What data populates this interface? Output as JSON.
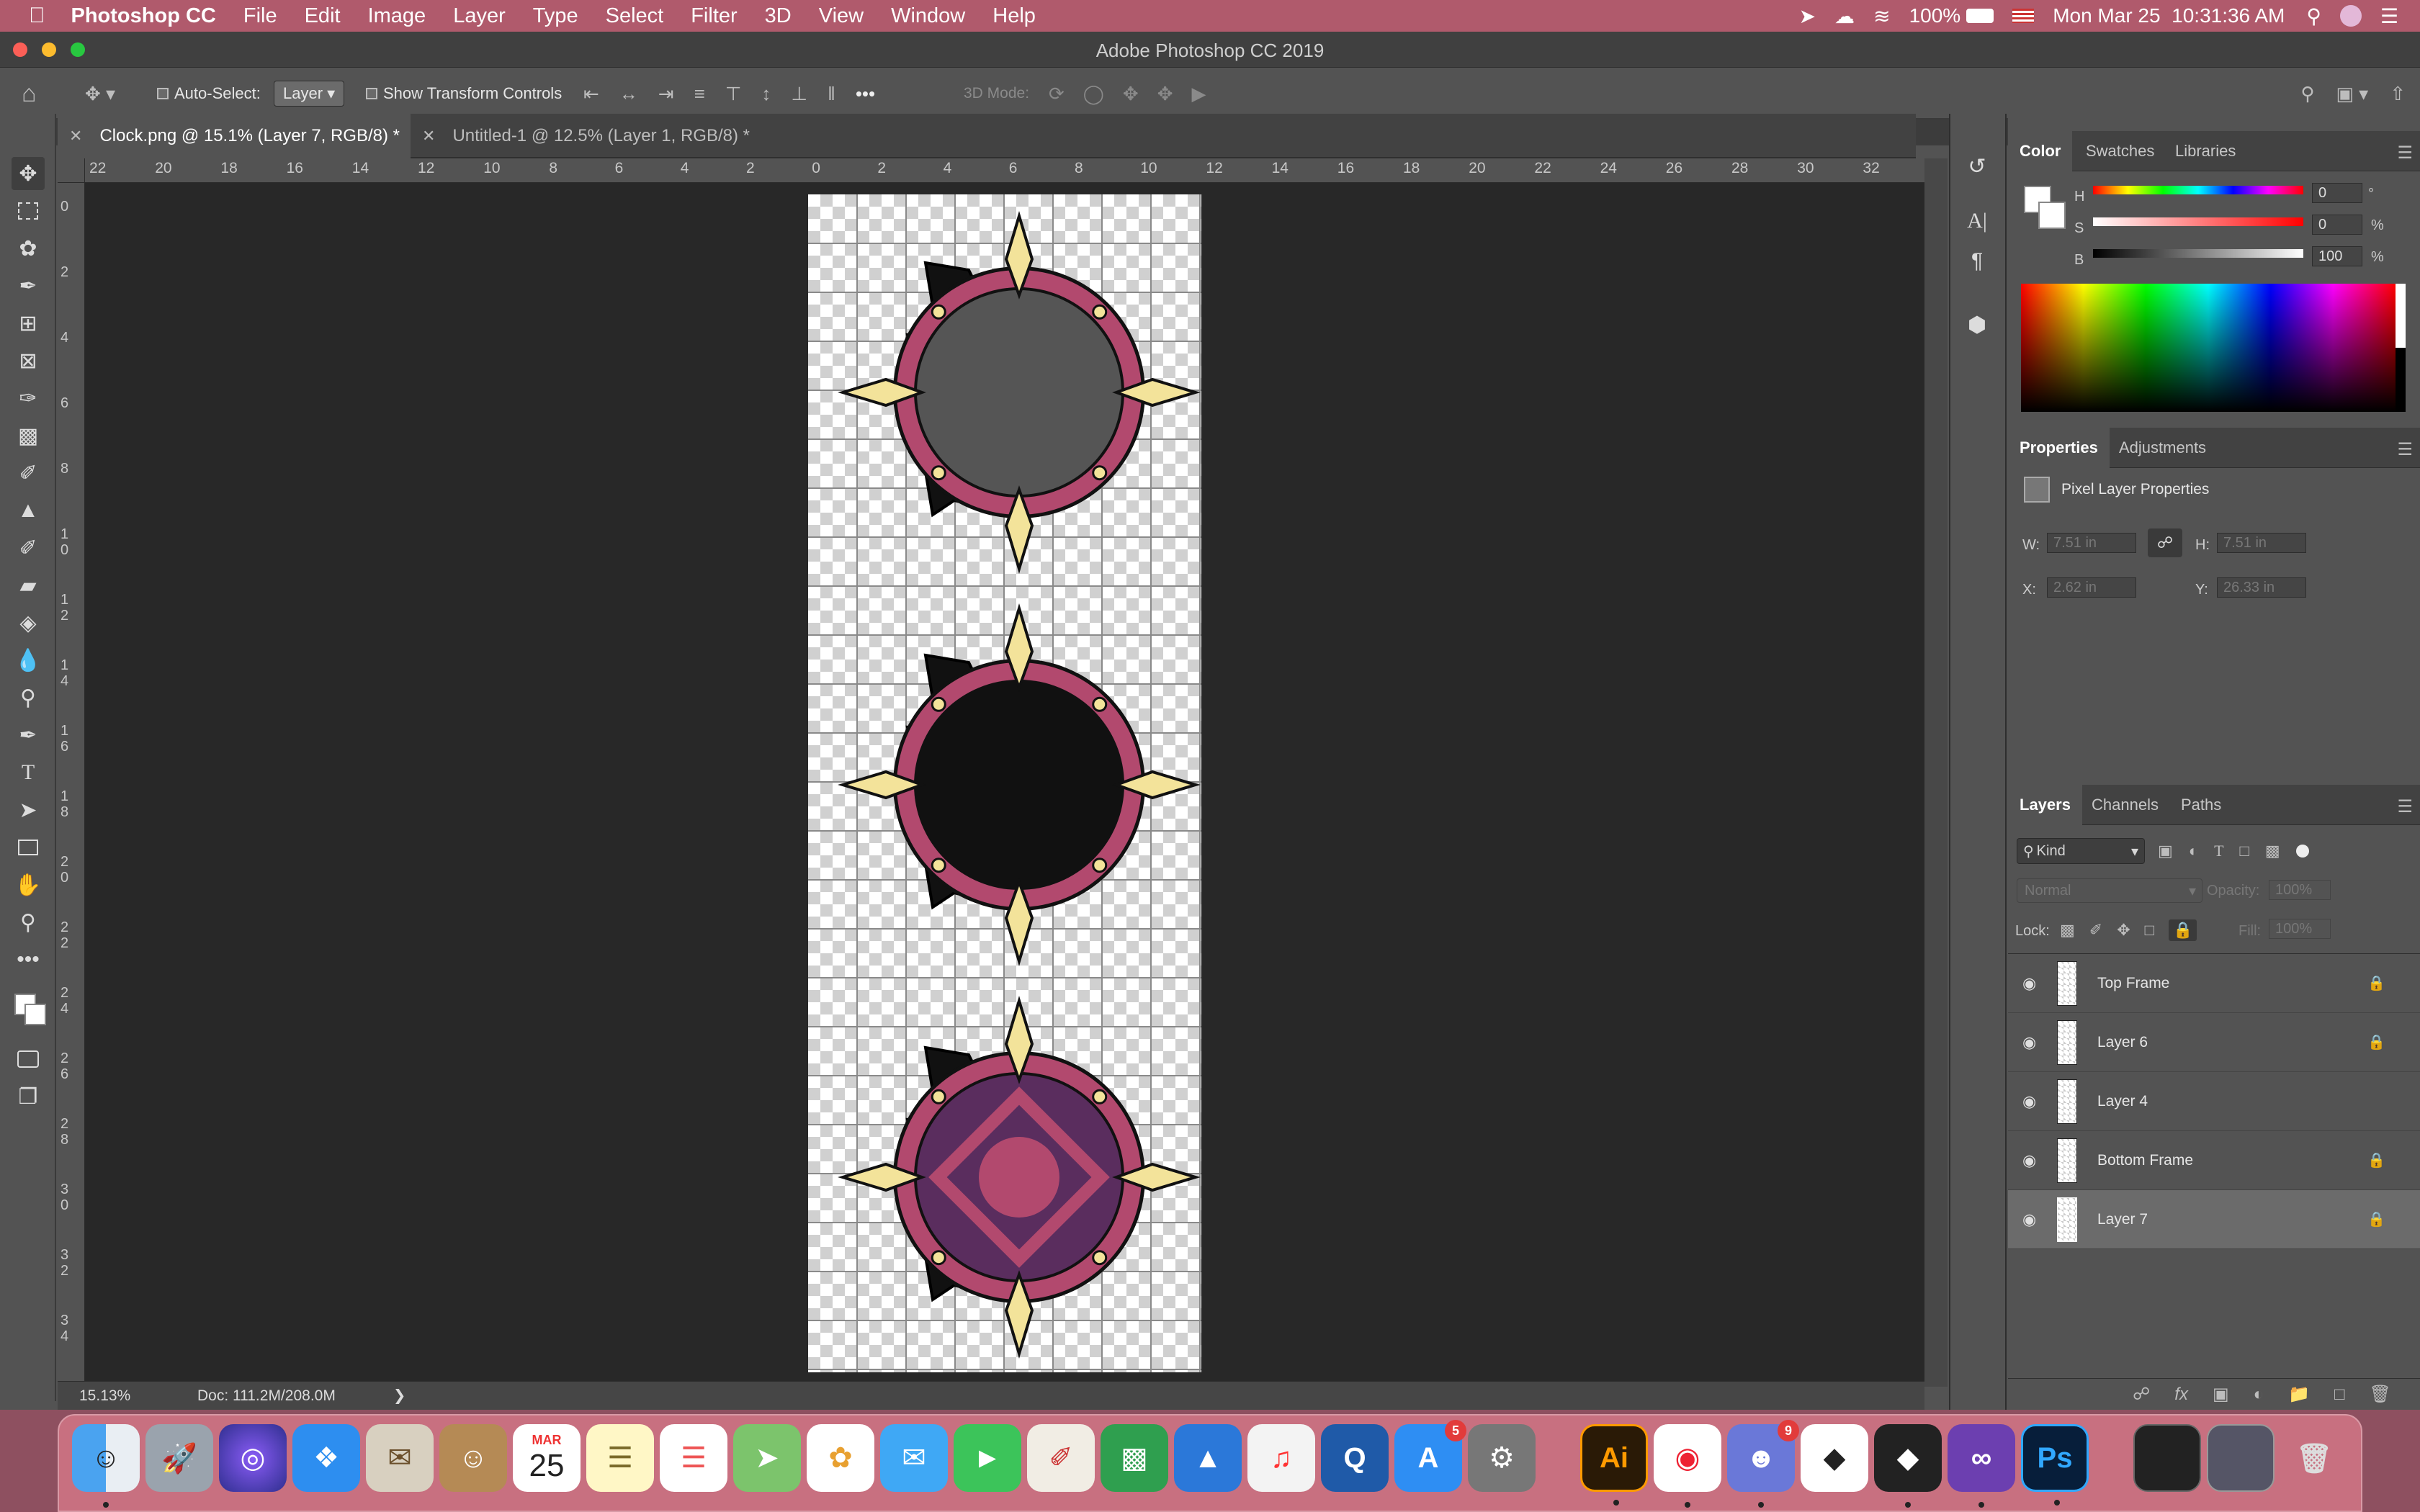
{
  "menubar": {
    "app": "Photoshop CC",
    "items": [
      "File",
      "Edit",
      "Image",
      "Layer",
      "Type",
      "Select",
      "Filter",
      "3D",
      "View",
      "Window",
      "Help"
    ],
    "battery": "100%",
    "datetime": "Mon Mar 25  10:31:36 AM"
  },
  "window": {
    "title": "Adobe Photoshop CC 2019"
  },
  "options": {
    "auto_select": "Auto-Select:",
    "layer_mode": "Layer",
    "show_transform": "Show Transform Controls",
    "mode_3d": "3D Mode:"
  },
  "tabs": [
    {
      "label": "Clock.png @ 15.1% (Layer 7, RGB/8) *"
    },
    {
      "label": "Untitled-1 @ 12.5% (Layer 1, RGB/8) *"
    }
  ],
  "ruler": {
    "h_labels": [
      "22",
      "20",
      "18",
      "16",
      "14",
      "12",
      "10",
      "8",
      "6",
      "4",
      "2",
      "0",
      "2",
      "4",
      "6",
      "8",
      "10",
      "12",
      "14",
      "16",
      "18",
      "20",
      "22",
      "24",
      "26",
      "28",
      "30",
      "32"
    ],
    "v_labels": [
      "0",
      "2",
      "4",
      "6",
      "8",
      "1\n0",
      "1\n2",
      "1\n4",
      "1\n6",
      "1\n8",
      "2\n0",
      "2\n2",
      "2\n4",
      "2\n6",
      "2\n8",
      "3\n0",
      "3\n2",
      "3\n4"
    ]
  },
  "status": {
    "zoom": "15.13%",
    "doc": "Doc: 111.2M/208.0M"
  },
  "color_panel": {
    "tabs": [
      "Color",
      "Swatches",
      "Libraries"
    ],
    "h_label": "H",
    "h_value": "0",
    "h_unit": "°",
    "s_label": "S",
    "s_value": "0",
    "s_unit": "%",
    "b_label": "B",
    "b_value": "100",
    "b_unit": "%"
  },
  "properties": {
    "tabs": [
      "Properties",
      "Adjustments"
    ],
    "heading": "Pixel Layer Properties",
    "w_label": "W:",
    "w_value": "7.51 in",
    "h_label": "H:",
    "h_value": "7.51 in",
    "x_label": "X:",
    "x_value": "2.62 in",
    "y_label": "Y:",
    "y_value": "26.33 in"
  },
  "layers_panel": {
    "tabs": [
      "Layers",
      "Channels",
      "Paths"
    ],
    "kind": "Kind",
    "blend": "Normal",
    "opacity_label": "Opacity:",
    "opacity": "100%",
    "lock_label": "Lock:",
    "fill_label": "Fill:",
    "fill": "100%",
    "layers": [
      {
        "name": "Top Frame",
        "locked": true
      },
      {
        "name": "Layer 6",
        "locked": true
      },
      {
        "name": "Layer 4",
        "locked": false
      },
      {
        "name": "Bottom Frame",
        "locked": true
      },
      {
        "name": "Layer 7",
        "locked": true,
        "selected": true
      }
    ]
  },
  "dock": {
    "calendar_month": "MAR",
    "calendar_day": "25",
    "appstore_badge": "5",
    "discord_badge": "9",
    "illustrator": "Ai",
    "photoshop": "Ps"
  },
  "colors": {
    "menubar": "#b05a6c",
    "ring": "#b2496e",
    "spike": "#f3e39a",
    "inner_fill_top": "#555555",
    "inner_fill_bottom": "#5a2d5e"
  }
}
